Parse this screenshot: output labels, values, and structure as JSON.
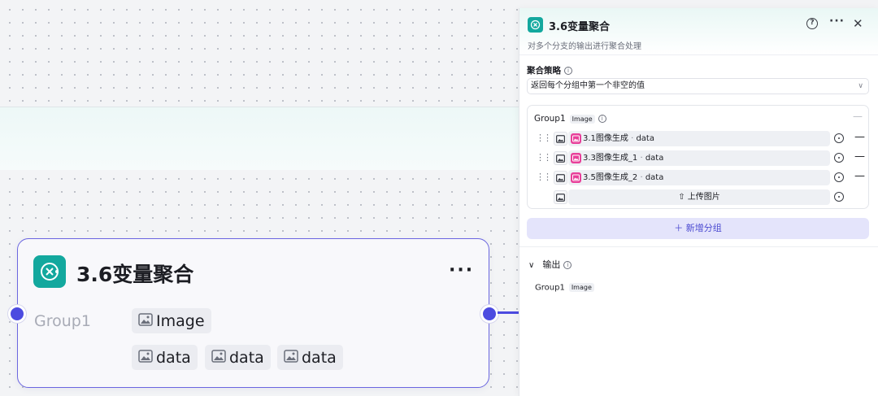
{
  "colors": {
    "accent": "#4c4be0",
    "node_icon_bg": "#13a89e",
    "image_badge": "#e8409a",
    "add_group_bg": "#e4e4fb"
  },
  "node": {
    "title": "3.6变量聚合",
    "more": "···",
    "group_label": "Group1",
    "type_chip": "Image",
    "data_chips": [
      "data",
      "data",
      "data"
    ]
  },
  "panel": {
    "title": "3.6变量聚合",
    "description": "对多个分支的输出进行聚合处理",
    "help_icon": "?",
    "more": "···",
    "close": "✕",
    "strategy": {
      "label": "聚合策略",
      "info": "i",
      "selected": "返回每个分组中第一个非空的值"
    },
    "group": {
      "title": "Group1",
      "type_tag": "Image",
      "info": "i",
      "collapse": "—",
      "rows": [
        {
          "source": "3.1图像生成",
          "sep": " · ",
          "field": "data"
        },
        {
          "source": "3.3图像生成_1",
          "sep": " · ",
          "field": "data"
        },
        {
          "source": "3.5图像生成_2",
          "sep": " · ",
          "field": "data"
        }
      ],
      "upload_label": "上传图片",
      "upload_icon": "⇧"
    },
    "add_group_label": "＋ 新增分组",
    "output": {
      "label": "输出",
      "info": "i",
      "arrow": "∨",
      "item_name": "Group1",
      "item_type": "Image"
    }
  }
}
